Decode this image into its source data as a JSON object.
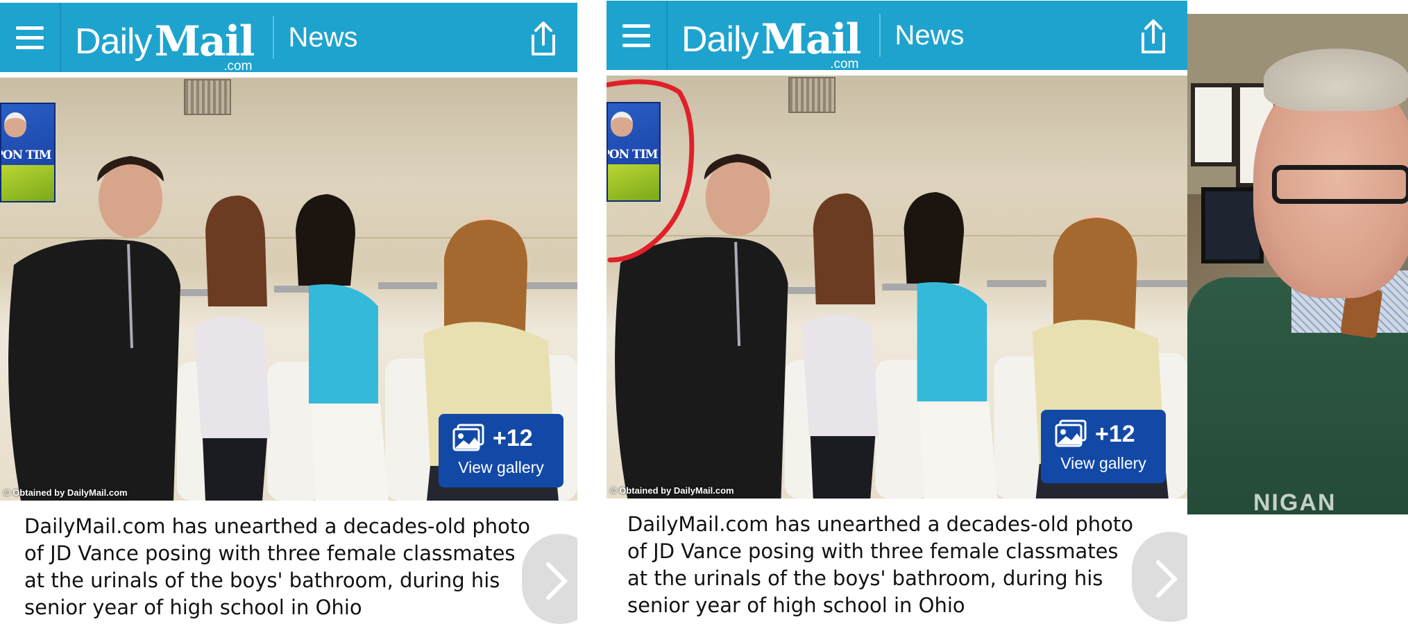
{
  "panels": [
    {
      "header": {
        "brand_daily": "Daily",
        "brand_mail": "Mail",
        "brand_domain": ".com",
        "section": "News"
      },
      "photo": {
        "credit": "© Obtained by DailyMail.com",
        "overlay_label": "PON TIM"
      },
      "gallery": {
        "count": "+12",
        "label": "View gallery"
      },
      "caption": "DailyMail.com has unearthed a decades-old photo of JD Vance posing with three female classmates at the urinals of the boys' bathroom, during his senior year of high school in Ohio"
    },
    {
      "header": {
        "brand_daily": "Daily",
        "brand_mail": "Mail",
        "brand_domain": ".com",
        "section": "News"
      },
      "photo": {
        "credit": "© Obtained by DailyMail.com",
        "overlay_label": "PON TIM"
      },
      "gallery": {
        "count": "+12",
        "label": "View gallery"
      },
      "caption": "DailyMail.com has unearthed a decades-old photo of JD Vance posing with three female classmates at the urinals of the boys' bathroom, during his senior year of high school in Ohio"
    }
  ],
  "right_photo": {
    "sweater_text": "NIGAN"
  },
  "colors": {
    "header_bg": "#1ea3cf",
    "gallery_bg": "#1249a7",
    "annotation": "#e0202a"
  },
  "icons": [
    "menu-icon",
    "share-icon",
    "gallery-icon",
    "chevron-right-icon"
  ]
}
